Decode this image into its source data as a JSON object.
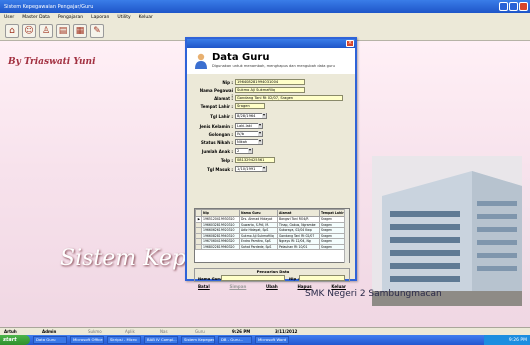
{
  "app": {
    "title": "Sistem Kepegawaian Pengajar/Guru",
    "menu": [
      "User",
      "Master Data",
      "Pengajaran",
      "Laporan",
      "Utility",
      "Keluar"
    ]
  },
  "desktop": {
    "author": "By Triaswati Yuni",
    "banner": "Sistem Kepegawaian Guru",
    "school": "SMK Negeri 2 Sambungmacan"
  },
  "dialog": {
    "title": "Data Guru",
    "subtitle": "Digunakan untuk menambah, menghapus dan mengubah data guru",
    "fields": {
      "nip_label": "Nip :",
      "nip_value": "196408281994031004",
      "nama_label": "Nama Pegawai :",
      "nama_value": "Sukmo Aji Sukmafiliq",
      "alamat_label": "Alamat :",
      "alamat_value": "Gondang Tani Rt 02/07, Sragen",
      "tempat_label": "Tempat Lahir :",
      "tempat_value": "Sragen",
      "tgl_label": "Tgl Lahir :",
      "tgl_value": "8/28/1964",
      "jk_label": "Jenis Kelamin :",
      "jk_value": "Laki-laki",
      "gol_label": "Golongan :",
      "gol_value": "IV/b",
      "status_label": "Status Nikah :",
      "status_value": "Nikah",
      "anak_label": "Jumlah Anak :",
      "anak_value": "2",
      "telp_label": "Telp :",
      "telp_value": "081329425561",
      "masuk_label": "Tgl Masuk :",
      "masuk_value": "1/10/1991"
    },
    "table": {
      "headers": [
        "Nip",
        "Nama Guru",
        "Alamat",
        "Tempat Lahir"
      ],
      "rows": [
        [
          "1965120419930310",
          "Drs. Ahmad Hidayat",
          "Bangsri Tani RO4/R",
          "Sragen"
        ],
        [
          "1966032819920310",
          "Suwarto, S.PdI, M.",
          "Tinap, Gabus, Ngrambe",
          "Sragen"
        ],
        [
          "1966062619920310",
          "Adiz Hidayat, SpS",
          "Sukoraya, 02/04 Kwp",
          "Sragen"
        ],
        [
          "1966082819940310",
          "Sukmo Aji Sukmafiliq",
          "Gondang Tani Rt 02/07",
          "Sragen"
        ],
        [
          "1967060419960320",
          "Endro Pamitro, SpS",
          "Ngrayu Rt 12/04, Ng",
          "Sragen"
        ],
        [
          "1968022819960320",
          "Sahat Pardede, SpS",
          "Pelauhan Rt 10/01",
          "Sragen"
        ]
      ]
    },
    "search": {
      "title": "Pencarian Data",
      "nama_label": "Nama Guru :",
      "nip_label": "Nip :"
    },
    "buttons": [
      "Batal",
      "Simpan",
      "Ubah",
      "Hapus",
      "Keluar"
    ]
  },
  "statusbar": {
    "user_label": "Artuh",
    "user_value": "Admin",
    "field3": "Sukmo",
    "field4": "Aplik",
    "field5": "Nas",
    "field6": "Guru",
    "time": "9:26 PM",
    "date": "3/11/2012"
  },
  "taskbar": {
    "start": "start",
    "tasks": [
      "Data Guru",
      "Microsoft Office",
      "Skripsi - Micro",
      "BAB IV Compl...",
      "Sistem Kepegawai...",
      "DB - Guru...",
      "Microsoft Word"
    ],
    "clock": "9:26 PM"
  }
}
